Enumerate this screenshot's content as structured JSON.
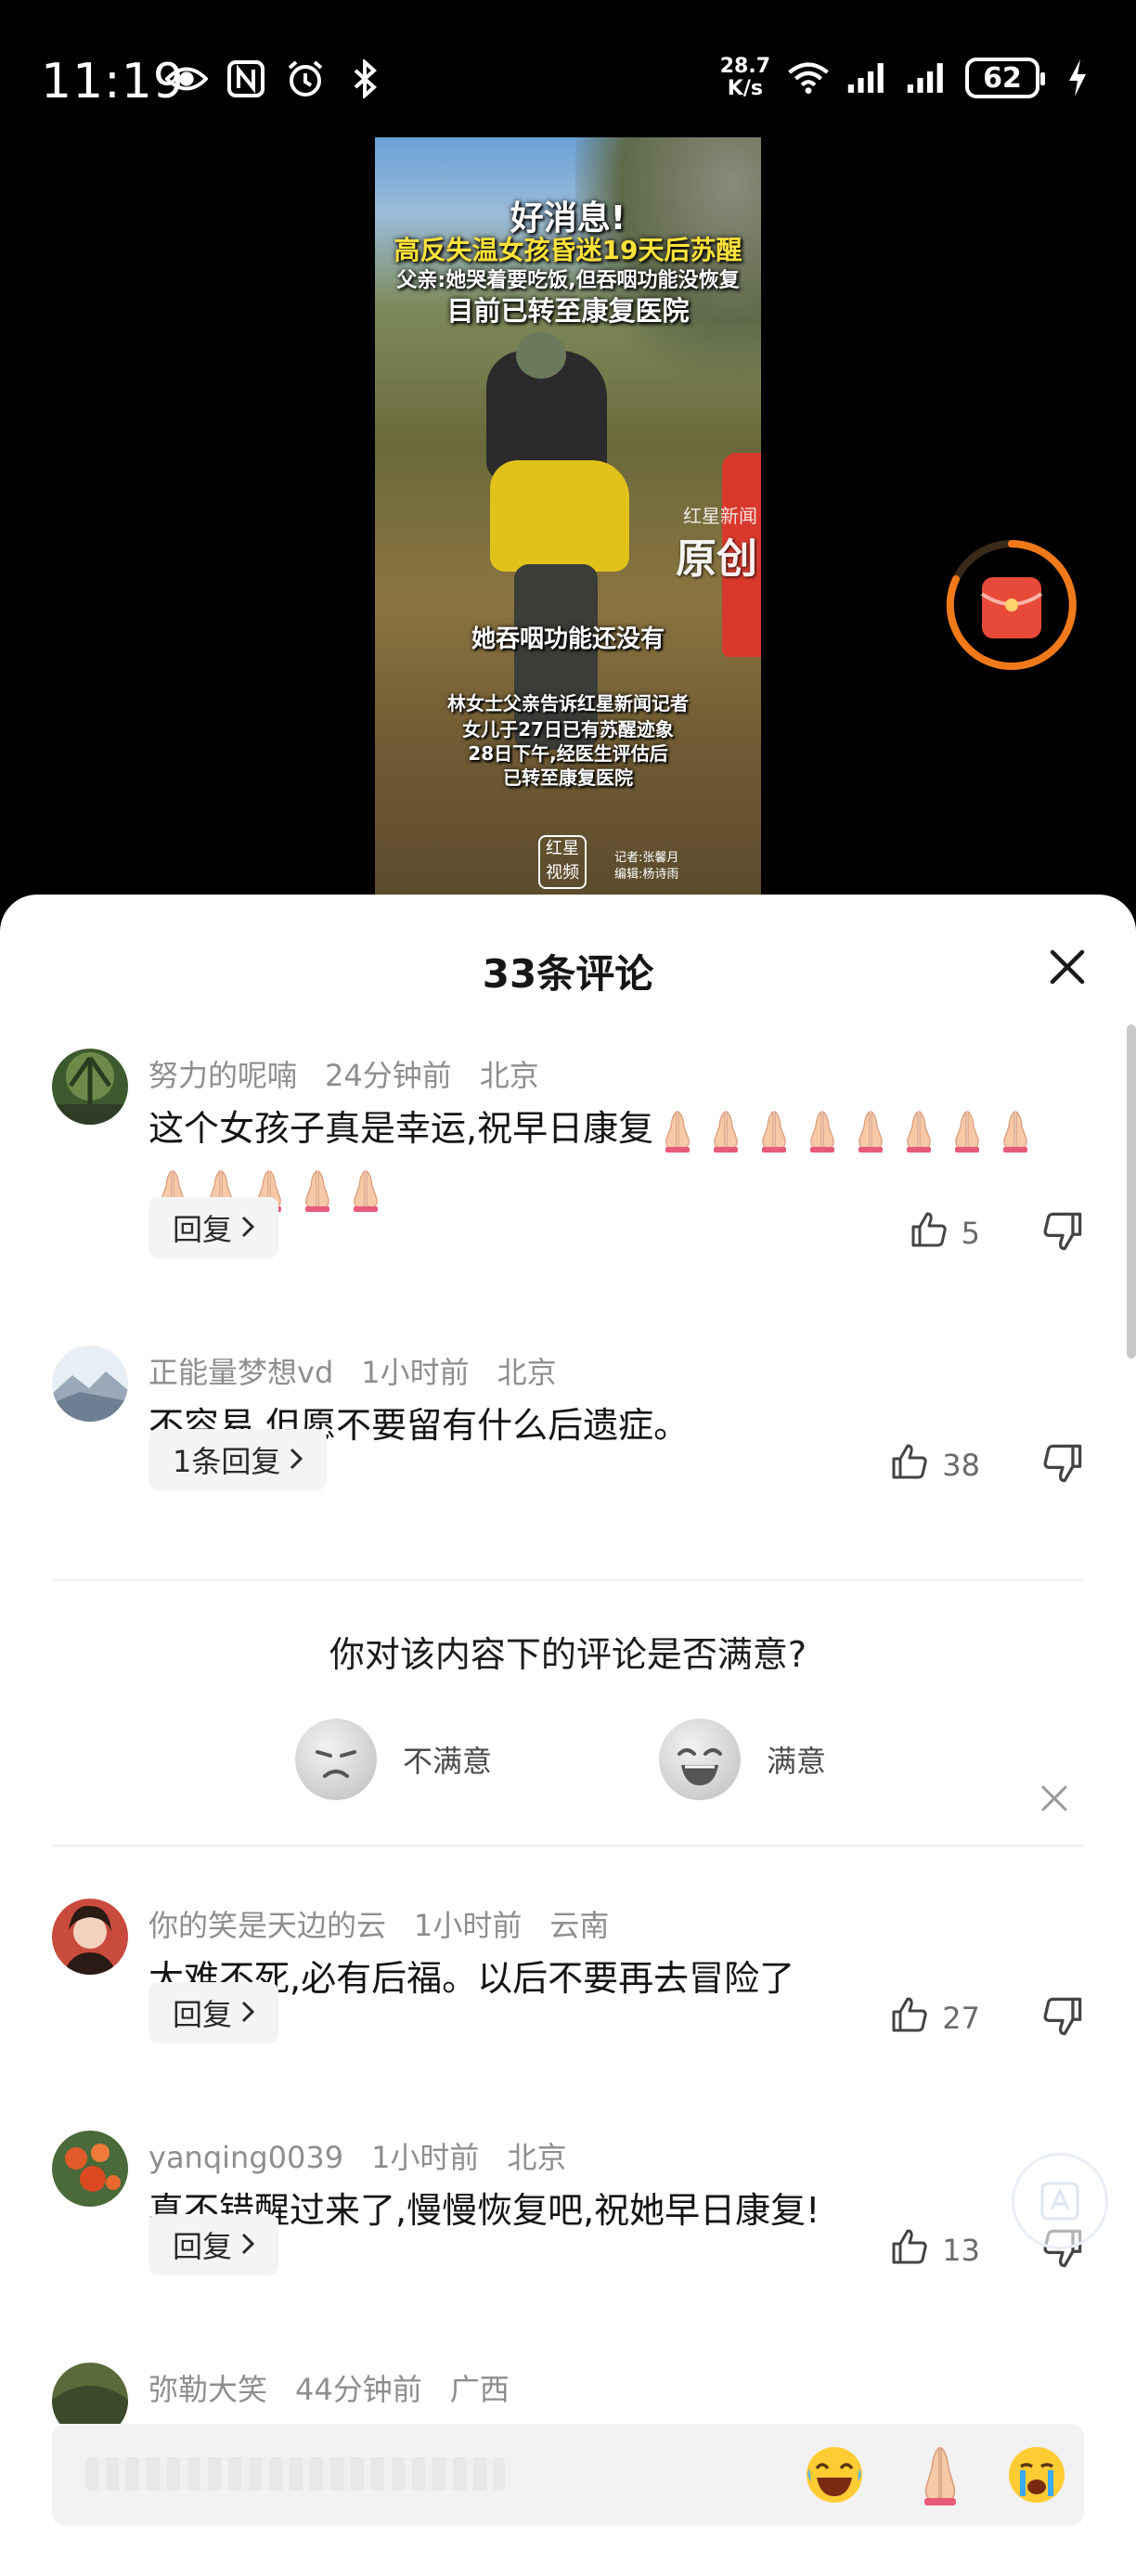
{
  "status_bar": {
    "time": "11:19",
    "net_speed_value": "28.7",
    "net_speed_unit": "K/s",
    "battery": "62"
  },
  "video": {
    "headline1": "好消息!",
    "headline2": "高反失温女孩昏迷19天后苏醒",
    "headline3": "父亲:她哭着要吃饭,但吞咽功能没恢复",
    "headline4": "目前已转至康复医院",
    "watermark_small": "红星新闻",
    "watermark": "原创",
    "subtitle": "她吞咽功能还没有",
    "caption1": "林女士父亲告诉红星新闻记者",
    "caption2": "女儿于27日已有苏醒迹象",
    "caption3": "28日下午,经医生评估后",
    "caption4": "已转至康复医院",
    "logo": "红星视频",
    "credit1": "记者:张馨月",
    "credit2": "编辑:杨诗雨"
  },
  "sheet": {
    "title": "33条评论"
  },
  "comments": [
    {
      "user": "努力的呢喃",
      "time": "24分钟前",
      "location": "北京",
      "text": "这个女孩子真是幸运,祝早日康复",
      "reply_label": "回复",
      "likes": "5"
    },
    {
      "user": "正能量梦想vd",
      "time": "1小时前",
      "location": "北京",
      "text": "不容易,但愿不要留有什么后遗症。",
      "reply_label": "1条回复",
      "likes": "38"
    },
    {
      "user": "你的笑是天边的云",
      "time": "1小时前",
      "location": "云南",
      "text": "大难不死,必有后福。以后不要再去冒险了",
      "reply_label": "回复",
      "likes": "27"
    },
    {
      "user": "yanqing0039",
      "time": "1小时前",
      "location": "北京",
      "text": "真不错醒过来了,慢慢恢复吧,祝她早日康复!",
      "reply_label": "回复",
      "likes": "13"
    },
    {
      "user": "弥勒大笑",
      "time": "44分钟前",
      "location": "广西"
    }
  ],
  "survey": {
    "question": "你对该内容下的评论是否满意?",
    "option_bad": "不满意",
    "option_good": "满意"
  },
  "colors": {
    "sheet_bg": "#ffffff",
    "meta_gray": "#8e8e8e",
    "red_packet": "#e84a3a",
    "timer_ring": "#f07a1a"
  }
}
